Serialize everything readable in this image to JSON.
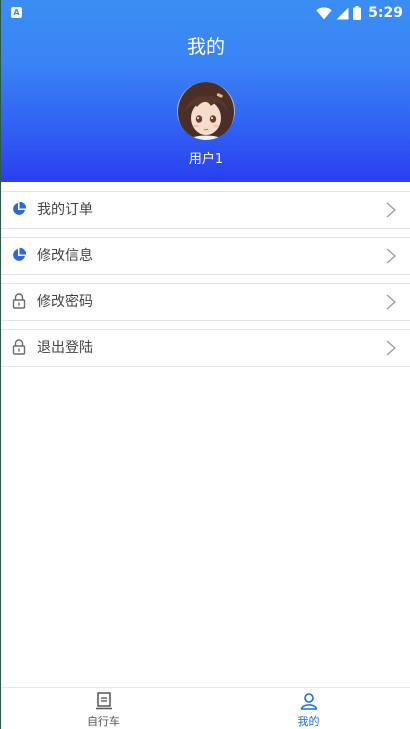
{
  "status_bar": {
    "left_badge": "A",
    "time": "5:29"
  },
  "header": {
    "title": "我的",
    "username": "用户1"
  },
  "menu": [
    {
      "label": "我的订单",
      "icon": "pie-chart-icon"
    },
    {
      "label": "修改信息",
      "icon": "pie-chart-icon"
    },
    {
      "label": "修改密码",
      "icon": "lock-icon"
    },
    {
      "label": "退出登陆",
      "icon": "lock-icon"
    }
  ],
  "bottom_nav": [
    {
      "label": "自行车",
      "icon": "document-icon",
      "active": false
    },
    {
      "label": "我的",
      "icon": "user-icon",
      "active": true
    }
  ],
  "colors": {
    "accent": "#1e6fd9",
    "header_top": "#3a8ef3",
    "header_bottom": "#2a3ef0",
    "inactive": "#555555"
  }
}
